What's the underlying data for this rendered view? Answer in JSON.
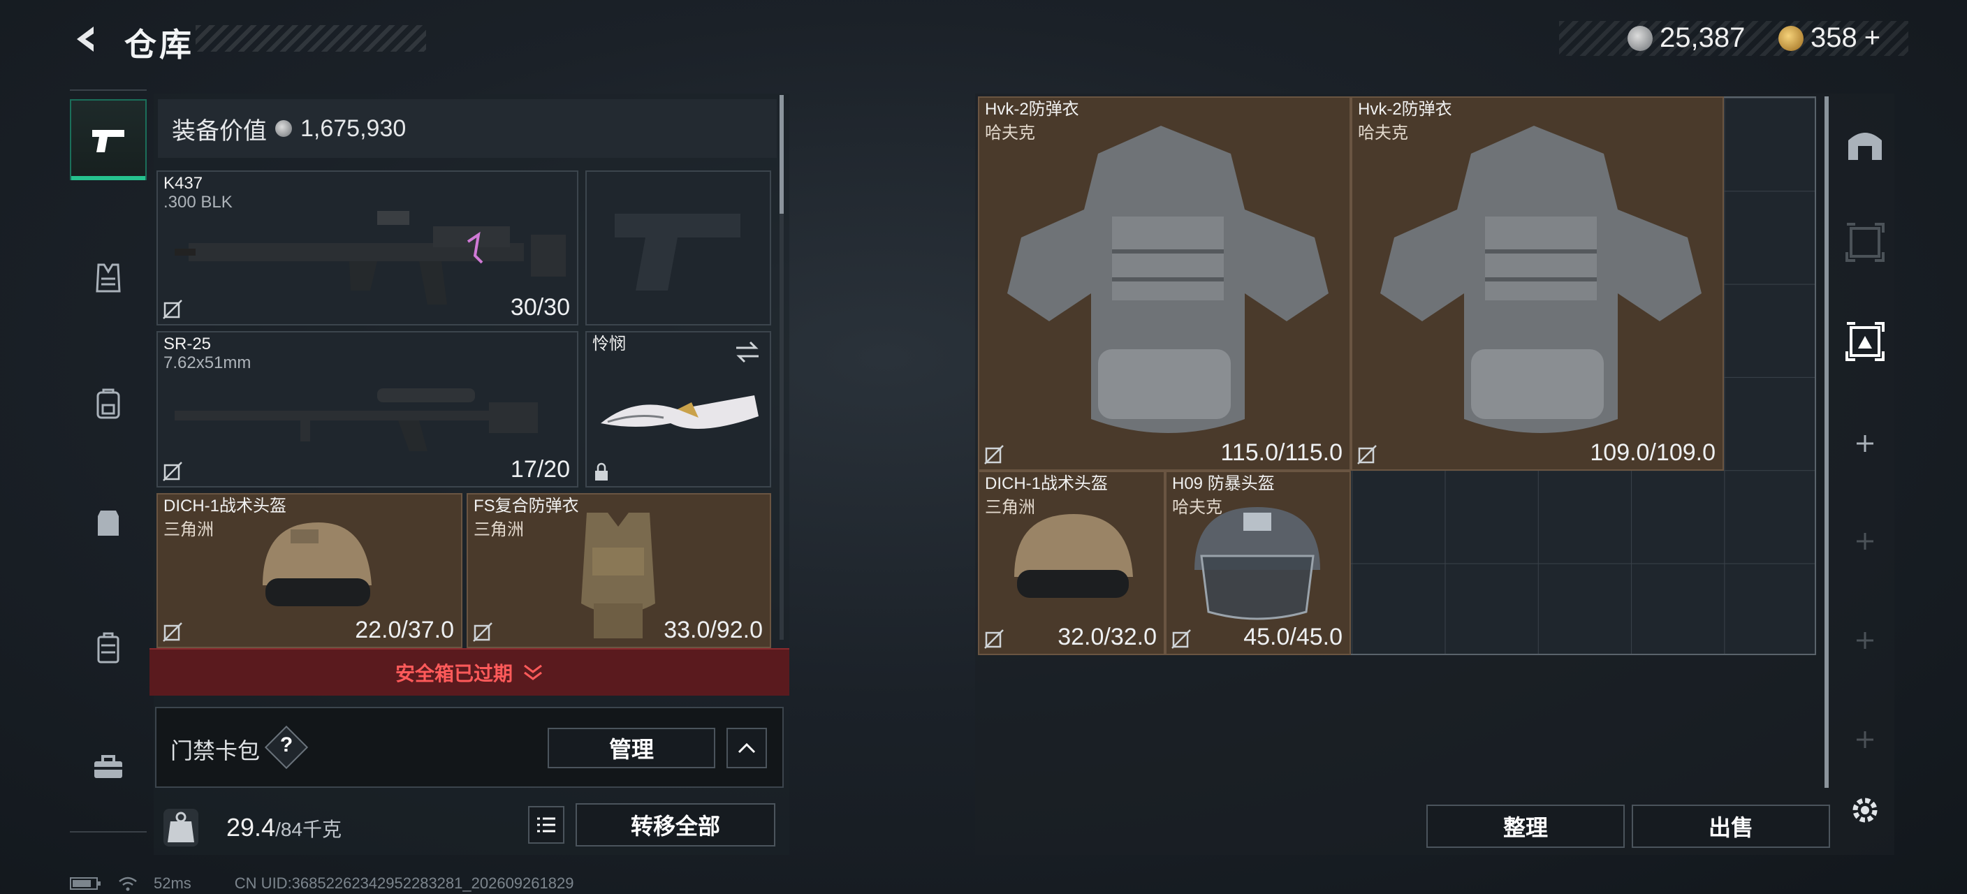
{
  "header": {
    "title": "仓库",
    "currency_silver": "25,387",
    "currency_gold": "358",
    "plus": "+"
  },
  "equipment_value": {
    "label": "装备价值",
    "value": "1,675,930"
  },
  "loadout": {
    "primary": {
      "name": "K437",
      "caliber": ".300 BLK",
      "ammo": "30/30"
    },
    "secondary": {
      "name": "SR-25",
      "caliber": "7.62x51mm",
      "ammo": "17/20"
    },
    "melee": {
      "name": "怜悯"
    },
    "helmet": {
      "name": "DICH-1战术头盔",
      "maker": "三角洲",
      "durability": "22.0/37.0"
    },
    "armor": {
      "name": "FS复合防弹衣",
      "maker": "三角洲",
      "durability": "33.0/92.0"
    }
  },
  "safe_box": {
    "label": "安全箱已过期"
  },
  "keycard": {
    "label": "门禁卡包",
    "help": "?",
    "manage_label": "管理"
  },
  "capacity": {
    "current": "29.4",
    "max_unit": "/84千克",
    "transfer_all_label": "转移全部"
  },
  "storage_items": [
    {
      "name": "Hvk-2防弹衣",
      "maker": "哈夫克",
      "durability": "115.0/115.0"
    },
    {
      "name": "Hvk-2防弹衣",
      "maker": "哈夫克",
      "durability": "109.0/109.0"
    },
    {
      "name": "DICH-1战术头盔",
      "maker": "三角洲",
      "durability": "32.0/32.0"
    },
    {
      "name": "H09 防暴头盔",
      "maker": "哈夫克",
      "durability": "45.0/45.0"
    }
  ],
  "actions": {
    "sort_label": "整理",
    "sell_label": "出售"
  },
  "status": {
    "ping": "52ms",
    "uid": "CN UID:3685226234295228328​1_202609261829"
  },
  "colors": {
    "accent": "#26c28e",
    "alert": "#ff5a5a",
    "item_brown": "#4a3a2b"
  }
}
